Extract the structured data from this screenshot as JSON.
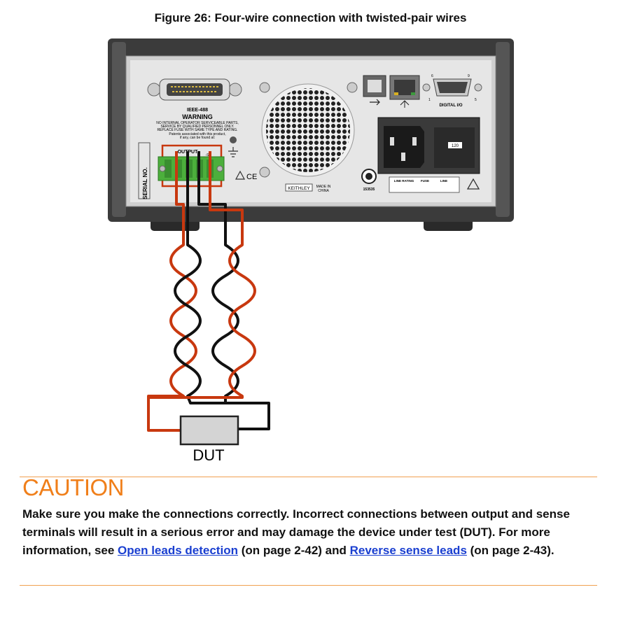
{
  "figure": {
    "title": "Figure 26: Four-wire connection with twisted-pair wires",
    "panel": {
      "ieee_label": "IEEE-488",
      "warning_title": "WARNING",
      "warning_lines": [
        "NO INTERNAL OPERATOR SERVICEABLE PARTS,",
        "SERVICE BY QUALIFIED PERSONNEL ONLY.",
        "REPLACE FUSE WITH SAME TYPE AND RATING.",
        "Patents associated with this product,",
        "if any, can be found at:"
      ],
      "serial_label": "SERIAL NO.",
      "output_label": "OUTPUT",
      "sense_label": "-S",
      "ce_mark": "CE",
      "brand": "KEITHLEY",
      "made_in": "MADE IN",
      "country": "CHINA",
      "cert_number": "153535",
      "digital_io": "DIGITAL I/O",
      "fuse_value": "120",
      "line_rating": "LINE RATING",
      "fuse": "FUSE",
      "line": "LINE",
      "pin_labels": [
        "6",
        "9",
        "1",
        "5"
      ]
    },
    "dut_label": "DUT",
    "colors": {
      "force_wire": "#c8380f",
      "sense_wire": "#111111",
      "chassis": "#3a3a3a",
      "connector": "#4caf3c"
    }
  },
  "caution": {
    "title": "CAUTION",
    "text_before": "Make sure you make the connections correctly. Incorrect connections between output and sense terminals will result in a serious error and may damage the device under test (DUT). For more information, see ",
    "link1": "Open leads detection",
    "text_middle": " (on page 2-42) and ",
    "link2": "Reverse sense leads",
    "text_after": " (on page 2-43)."
  }
}
